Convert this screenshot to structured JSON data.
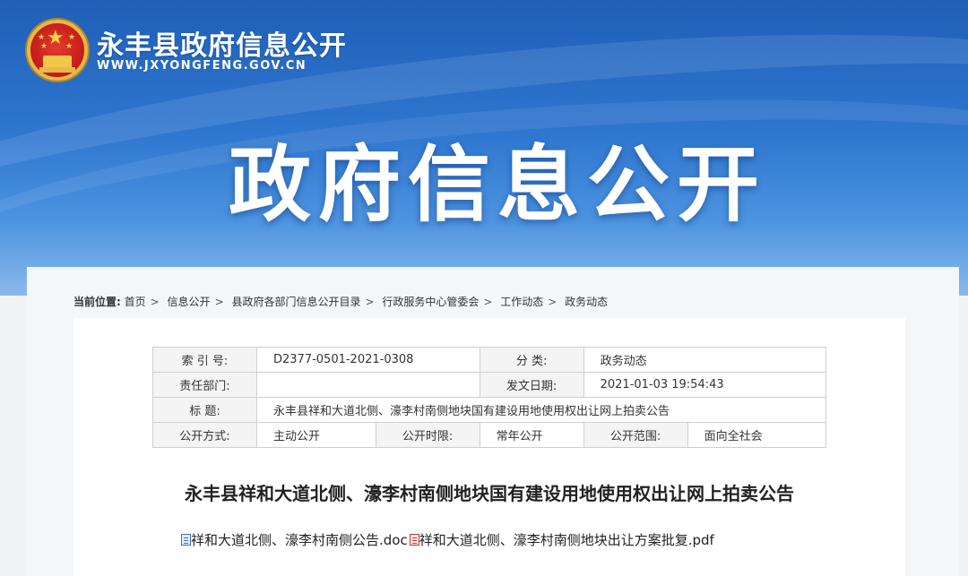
{
  "header": {
    "site_title": "永丰县政府信息公开",
    "site_url": "WWW.JXYONGFENG.GOV.CN",
    "hero_title": "政府信息公开"
  },
  "breadcrumb": {
    "label": "当前位置:",
    "items": [
      "首页",
      "信息公开",
      "县政府各部门信息公开目录",
      "行政服务中心管委会",
      "工作动态",
      "政务动态"
    ]
  },
  "meta_table": {
    "index_label": "索 引 号:",
    "index_value": "D2377-0501-2021-0308",
    "category_label": "分 类:",
    "category_value": "政务动态",
    "dept_label": "责任部门:",
    "dept_value": "",
    "date_label": "发文日期:",
    "date_value": "2021-01-03 19:54:43",
    "title_label": "标 题:",
    "title_value": "永丰县祥和大道北侧、濠李村南侧地块国有建设用地使用权出让网上拍卖公告",
    "method_label": "公开方式:",
    "method_value": "主动公开",
    "period_label": "公开时限:",
    "period_value": "常年公开",
    "scope_label": "公开范围:",
    "scope_value": "面向全社会"
  },
  "article": {
    "title": "永丰县祥和大道北侧、濠李村南侧地块国有建设用地使用权出让网上拍卖公告",
    "attachments": [
      {
        "name": "祥和大道北侧、濠李村南侧公告.doc",
        "icon": "doc-file-icon"
      },
      {
        "name": "祥和大道北侧、濠李村南侧地块出让方案批复.pdf",
        "icon": "pdf-file-icon"
      }
    ]
  }
}
